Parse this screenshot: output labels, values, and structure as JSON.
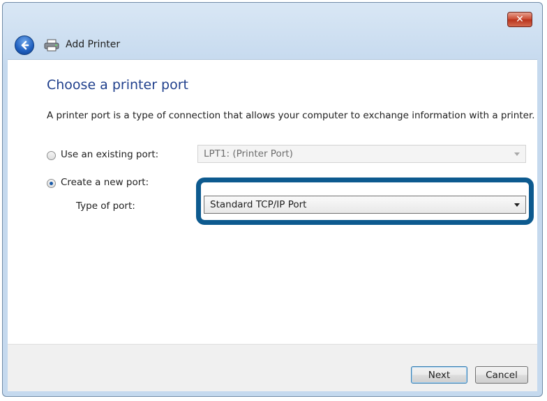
{
  "window": {
    "title": "Add Printer",
    "close_label": "✕"
  },
  "page": {
    "heading": "Choose a printer port",
    "description": "A printer port is a type of connection that allows your computer to exchange information with a printer."
  },
  "options": {
    "existing_port": {
      "label": "Use an existing port:",
      "selected": false,
      "value": "LPT1: (Printer Port)",
      "enabled": false
    },
    "new_port": {
      "label": "Create a new port:",
      "selected": true,
      "type_label": "Type of port:",
      "value": "Standard TCP/IP Port"
    }
  },
  "footer": {
    "next_label": "Next",
    "cancel_label": "Cancel"
  },
  "colors": {
    "highlight": "#0d5a8f",
    "heading": "#1f3f8c"
  }
}
